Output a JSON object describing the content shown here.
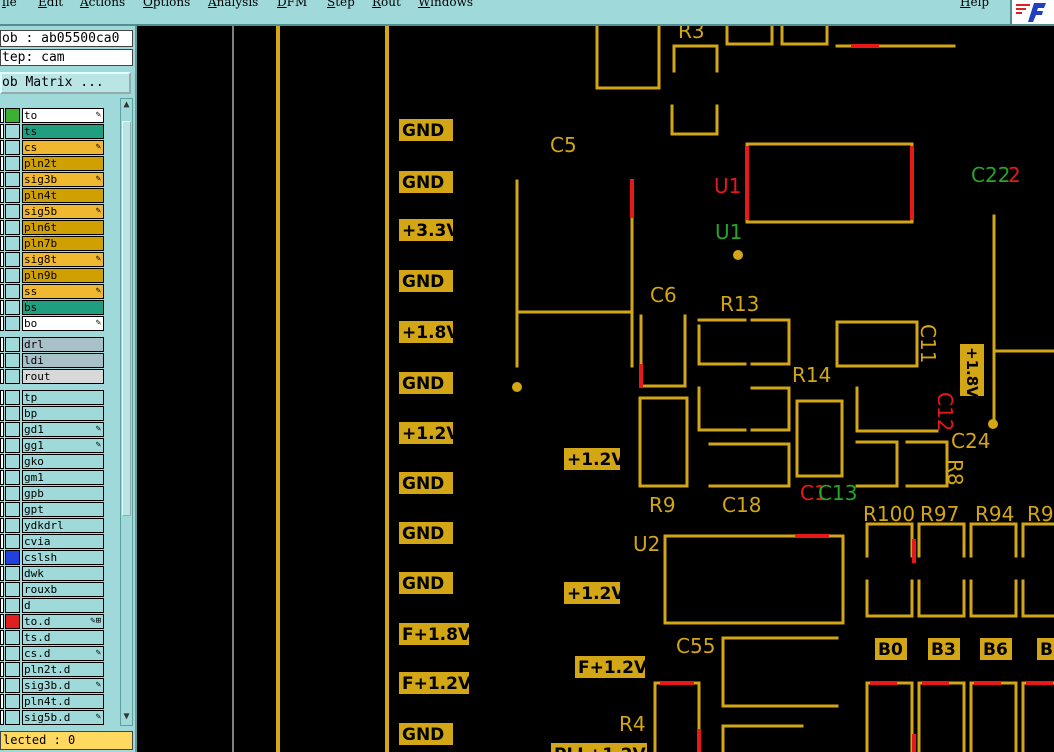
{
  "menu": {
    "items": [
      "ile",
      "Edit",
      "Actions",
      "Options",
      "Analysis",
      "DFM",
      "Step",
      "Rout",
      "Windows",
      "Help"
    ]
  },
  "job": {
    "label": "ob : ab05500ca0"
  },
  "step": {
    "label": "tep: cam"
  },
  "matrix_button": {
    "label": "ob Matrix ..."
  },
  "layers": [
    {
      "name": "to",
      "color": "#ffffff",
      "chk": "#3cb030",
      "mark": "✎"
    },
    {
      "name": "ts",
      "color": "#1f9f7f",
      "chk": "#9fd9d9",
      "mark": ""
    },
    {
      "name": "cs",
      "color": "#f0b830",
      "chk": "#9fd9d9",
      "mark": "✎"
    },
    {
      "name": "pln2t",
      "color": "#d0a000",
      "chk": "#9fd9d9",
      "mark": ""
    },
    {
      "name": "sig3b",
      "color": "#f0b830",
      "chk": "#9fd9d9",
      "mark": "✎"
    },
    {
      "name": "pln4t",
      "color": "#d0a000",
      "chk": "#9fd9d9",
      "mark": ""
    },
    {
      "name": "sig5b",
      "color": "#f0b830",
      "chk": "#9fd9d9",
      "mark": "✎"
    },
    {
      "name": "pln6t",
      "color": "#d0a000",
      "chk": "#9fd9d9",
      "mark": ""
    },
    {
      "name": "pln7b",
      "color": "#d0a000",
      "chk": "#9fd9d9",
      "mark": ""
    },
    {
      "name": "sig8t",
      "color": "#f0b830",
      "chk": "#9fd9d9",
      "mark": "✎"
    },
    {
      "name": "pln9b",
      "color": "#d0a000",
      "chk": "#9fd9d9",
      "mark": ""
    },
    {
      "name": "ss",
      "color": "#f0b830",
      "chk": "#9fd9d9",
      "mark": "✎"
    },
    {
      "name": "bs",
      "color": "#1f9f7f",
      "chk": "#9fd9d9",
      "mark": ""
    },
    {
      "name": "bo",
      "color": "#ffffff",
      "chk": "#9fd9d9",
      "mark": "✎"
    },
    {
      "name": "drl",
      "color": "#a8c0c8",
      "chk": "#9fd9d9",
      "mark": "",
      "gap": true
    },
    {
      "name": "ldi",
      "color": "#a8c0c8",
      "chk": "#9fd9d9",
      "mark": ""
    },
    {
      "name": "rout",
      "color": "#d8d8d8",
      "chk": "#9fd9d9",
      "mark": ""
    },
    {
      "name": "tp",
      "color": "#9fd9d9",
      "chk": "#9fd9d9",
      "mark": "",
      "gap": true
    },
    {
      "name": "bp",
      "color": "#9fd9d9",
      "chk": "#9fd9d9",
      "mark": ""
    },
    {
      "name": "gd1",
      "color": "#9fd9d9",
      "chk": "#9fd9d9",
      "mark": "✎"
    },
    {
      "name": "gg1",
      "color": "#9fd9d9",
      "chk": "#9fd9d9",
      "mark": "✎"
    },
    {
      "name": "gko",
      "color": "#9fd9d9",
      "chk": "#9fd9d9",
      "mark": ""
    },
    {
      "name": "gm1",
      "color": "#9fd9d9",
      "chk": "#9fd9d9",
      "mark": ""
    },
    {
      "name": "gpb",
      "color": "#9fd9d9",
      "chk": "#9fd9d9",
      "mark": ""
    },
    {
      "name": "gpt",
      "color": "#9fd9d9",
      "chk": "#9fd9d9",
      "mark": ""
    },
    {
      "name": "ydkdrl",
      "color": "#9fd9d9",
      "chk": "#9fd9d9",
      "mark": ""
    },
    {
      "name": "cvia",
      "color": "#9fd9d9",
      "chk": "#9fd9d9",
      "mark": ""
    },
    {
      "name": "cslsh",
      "color": "#9fd9d9",
      "chk": "#2040e0",
      "mark": ""
    },
    {
      "name": "dwk",
      "color": "#9fd9d9",
      "chk": "#9fd9d9",
      "mark": ""
    },
    {
      "name": "rouxb",
      "color": "#9fd9d9",
      "chk": "#9fd9d9",
      "mark": ""
    },
    {
      "name": "d",
      "color": "#9fd9d9",
      "chk": "#9fd9d9",
      "mark": ""
    },
    {
      "name": "to.d",
      "color": "#9fd9d9",
      "chk": "#e02020",
      "mark": "✎⊞"
    },
    {
      "name": "ts.d",
      "color": "#9fd9d9",
      "chk": "#9fd9d9",
      "mark": ""
    },
    {
      "name": "cs.d",
      "color": "#9fd9d9",
      "chk": "#9fd9d9",
      "mark": "✎"
    },
    {
      "name": "pln2t.d",
      "color": "#9fd9d9",
      "chk": "#9fd9d9",
      "mark": ""
    },
    {
      "name": "sig3b.d",
      "color": "#9fd9d9",
      "chk": "#9fd9d9",
      "mark": "✎"
    },
    {
      "name": "pln4t.d",
      "color": "#9fd9d9",
      "chk": "#9fd9d9",
      "mark": ""
    },
    {
      "name": "sig5b.d",
      "color": "#9fd9d9",
      "chk": "#9fd9d9",
      "mark": "✎"
    }
  ],
  "status": {
    "label": "lected : 0"
  },
  "pcb": {
    "colors": {
      "copper": "#d2a614",
      "red": "#e81818",
      "green": "#28a428",
      "background": "#000000"
    },
    "net_labels": [
      {
        "text": "GND"
      },
      {
        "text": "GND"
      },
      {
        "text": "+3.3V"
      },
      {
        "text": "GND"
      },
      {
        "text": "+1.8V"
      },
      {
        "text": "GND"
      },
      {
        "text": "+1.2V"
      },
      {
        "text": "GND"
      },
      {
        "text": "GND"
      },
      {
        "text": "GND"
      },
      {
        "text": "F+1.8V"
      },
      {
        "text": "F+1.2V"
      },
      {
        "text": "GND"
      },
      {
        "text": "+1.2V"
      },
      {
        "text": "+1.2V"
      },
      {
        "text": "F+1.2V"
      },
      {
        "text": "PLL+1.2V"
      },
      {
        "text": "+1.8V"
      },
      {
        "text": "B0"
      },
      {
        "text": "B3"
      },
      {
        "text": "B6"
      },
      {
        "text": "B"
      }
    ],
    "refdes": [
      {
        "text": "R3"
      },
      {
        "text": "C5"
      },
      {
        "text": "U1"
      },
      {
        "text": "U1"
      },
      {
        "text": "C22"
      },
      {
        "text": "2"
      },
      {
        "text": "C6"
      },
      {
        "text": "R13"
      },
      {
        "text": "C11"
      },
      {
        "text": "R14"
      },
      {
        "text": "C12"
      },
      {
        "text": "C24"
      },
      {
        "text": "R8"
      },
      {
        "text": "R9"
      },
      {
        "text": "C18"
      },
      {
        "text": "C1"
      },
      {
        "text": "C13"
      },
      {
        "text": "R100"
      },
      {
        "text": "R97"
      },
      {
        "text": "R94"
      },
      {
        "text": "R9"
      },
      {
        "text": "U2"
      },
      {
        "text": "C55"
      },
      {
        "text": "R4"
      }
    ]
  }
}
